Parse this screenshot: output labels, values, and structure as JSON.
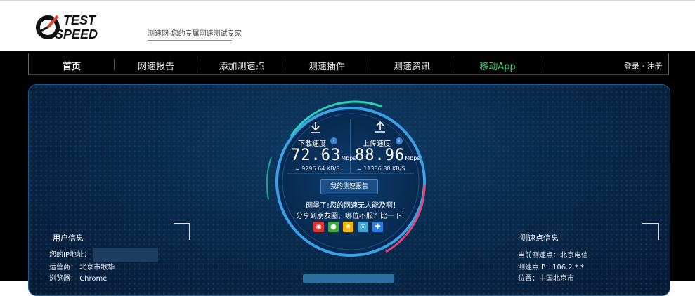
{
  "brand": {
    "logo_line1": "TEST",
    "logo_line2": "SPEED",
    "tagline": "测速网-您的专属网速测试专家"
  },
  "nav": {
    "items": [
      "首页",
      "网速报告",
      "添加测速点",
      "测速插件",
      "测速资讯",
      "移动App"
    ],
    "login": "登录",
    "dot": "·",
    "register": "注册"
  },
  "gauge": {
    "download": {
      "label": "下载速度",
      "value": "72.63",
      "unit": "Mbps",
      "kbs": "= 9296.64 KB/S"
    },
    "upload": {
      "label": "上传速度",
      "value": "88.96",
      "unit": "Mbps",
      "kbs": "= 11386.88 KB/S"
    },
    "info_badge": "i",
    "report_button": "我的测速报告",
    "message_line1": "碉堡了!您的网速无人能及啊！",
    "message_line2": "分享到朋友圈，哪位不服？比一下！"
  },
  "share_icons": [
    "weibo-icon",
    "wechat-icon",
    "qzone-icon",
    "tencent-weibo-icon",
    "more-share-icon"
  ],
  "user_info": {
    "title": "用户信息",
    "ip_label": "您的IP地址：",
    "isp": "运营商： 北京市歌华",
    "browser": "浏览器： Chrome"
  },
  "server_info": {
    "title": "测速点信息",
    "current": "当前测速点：北京电信",
    "ip": "测速点IP：106.2.*.*",
    "location": "位置：中国北京市"
  },
  "colors": {
    "accent_green": "#3fd27a",
    "panel_blue": "#0a2a4c",
    "ring_teal": "#2ad1b8",
    "ring_pink": "#e0457b"
  }
}
